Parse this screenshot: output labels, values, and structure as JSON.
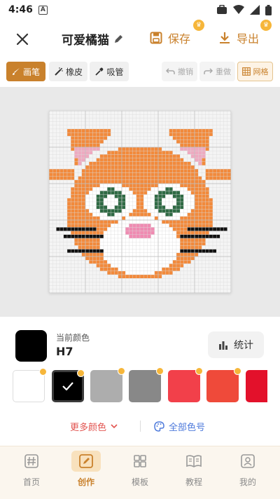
{
  "status_bar": {
    "time": "4:46",
    "notification_letter": "A"
  },
  "header": {
    "title": "可爱橘猫",
    "save_label": "保存",
    "export_label": "导出"
  },
  "toolbar": {
    "brush": "画笔",
    "eraser": "橡皮",
    "picker": "吸管",
    "undo": "撤销",
    "redo": "重做",
    "grid": "网格"
  },
  "color_panel": {
    "current_label": "当前颜色",
    "current_code": "H7",
    "current_color": "#000000",
    "stats_label": "统计",
    "swatches": [
      {
        "color": "#ffffff",
        "vip": true,
        "selected": false
      },
      {
        "color": "#000000",
        "vip": true,
        "selected": true
      },
      {
        "color": "#adadad",
        "vip": true,
        "selected": false
      },
      {
        "color": "#888888",
        "vip": true,
        "selected": false
      },
      {
        "color": "#f2404a",
        "vip": true,
        "selected": false
      },
      {
        "color": "#ef4a3a",
        "vip": true,
        "selected": false
      },
      {
        "color": "#e3112b",
        "vip": false,
        "selected": false
      }
    ],
    "more_colors": "更多颜色",
    "all_colors": "全部色号"
  },
  "nav": [
    {
      "label": "首页",
      "icon": "hash-icon",
      "active": false
    },
    {
      "label": "创作",
      "icon": "pen-icon",
      "active": true
    },
    {
      "label": "模板",
      "icon": "grid-icon",
      "active": false
    },
    {
      "label": "教程",
      "icon": "book-icon",
      "active": false
    },
    {
      "label": "我的",
      "icon": "profile-icon",
      "active": false
    }
  ],
  "colors": {
    "accent": "#c9812c",
    "cat_orange": "#f28a3c",
    "cat_white": "#ffffff",
    "ear_pink": "#eeaac0",
    "nose_pink": "#f08bb2",
    "eye_green": "#2f6a44",
    "whisker": "#111111"
  }
}
